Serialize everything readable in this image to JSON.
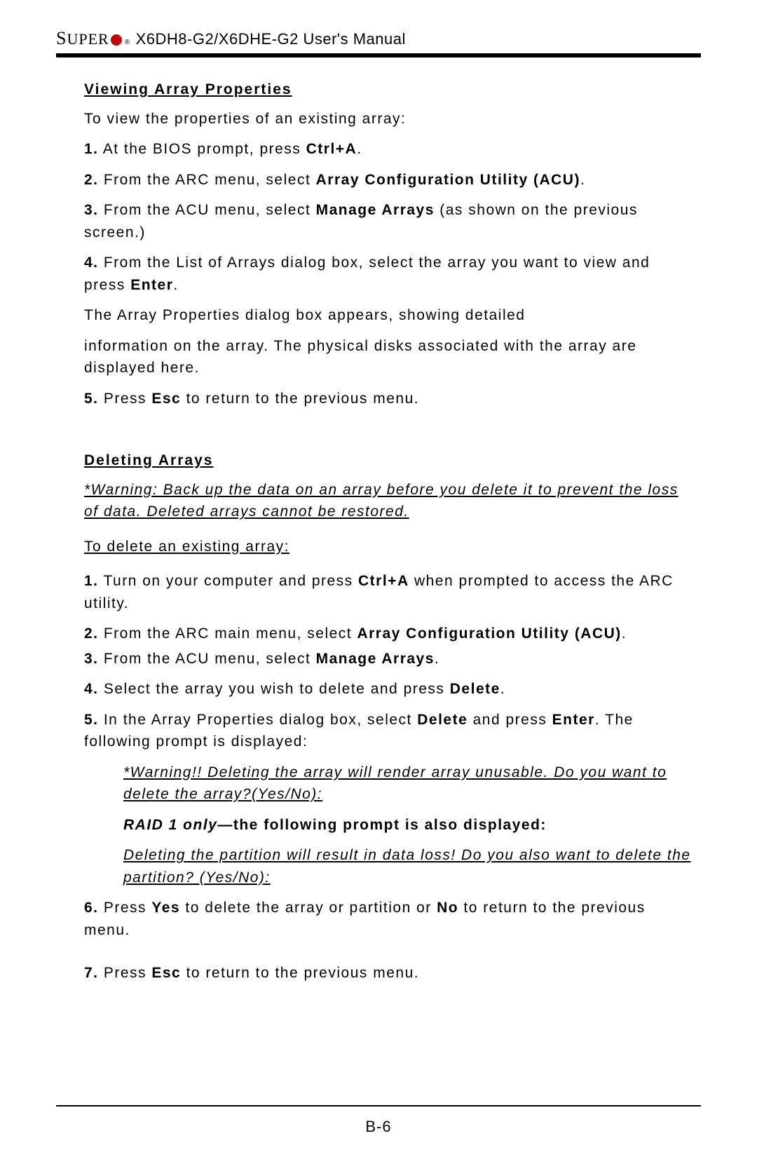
{
  "header": {
    "brand_prefix": "S",
    "brand_rest": "UPER",
    "registered": "®",
    "title": " X6DH8-G2/X6DHE-G2 User's Manual"
  },
  "section1": {
    "heading": "Viewing Array Properties",
    "intro": "To view the properties of an existing array:",
    "s1_pre": "1.",
    "s1_mid": " At the BIOS prompt, press ",
    "s1_b": "Ctrl+A",
    "s1_post": ".",
    "s2_pre": "2.",
    "s2_mid": " From the ARC menu, select ",
    "s2_b": "Array Configuration Utility (ACU)",
    "s2_post": ".",
    "s3_pre": "3.",
    "s3_mid": " From the ACU menu, select ",
    "s3_b": "Manage Arrays",
    "s3_post": " (as shown on the previous screen.)",
    "s4_pre": "4.",
    "s4_mid": " From the List of Arrays dialog box, select the array you want to view and press ",
    "s4_b": "Enter",
    "s4_post": ".",
    "p5": "The Array Properties dialog box appears, showing detailed",
    "p6": "information on the array. The physical disks associated with the array are displayed here.",
    "s5_pre": "5.",
    "s5_mid": " Press ",
    "s5_b": "Esc",
    "s5_post": " to return to the previous menu."
  },
  "section2": {
    "heading": "Deleting Arrays",
    "warning": "*Warning: Back up the data on an array before you delete it to prevent the loss of data.  Deleted arrays cannot be restored.",
    "intro": "To delete an existing array:",
    "s1_pre": "1.",
    "s1_mid": " Turn on your computer and press ",
    "s1_b": "Ctrl+A",
    "s1_post": " when prompted to access the ARC utility.",
    "s2_pre": "2.",
    "s2_mid": " From the ARC main menu, select ",
    "s2_b": "Array Configuration Utility (ACU)",
    "s2_post": ".",
    "s3_pre": "3.",
    "s3_mid": " From the ACU menu, select ",
    "s3_b": "Manage Arrays",
    "s3_post": ".",
    "s4_pre": "4.",
    "s4_mid": " Select the array you wish to delete and press ",
    "s4_b": "Delete",
    "s4_post": ".",
    "s5_pre": "5.",
    "s5_a": " In the Array Properties dialog box, select ",
    "s5_b1": "Delete",
    "s5_c": " and press ",
    "s5_b2": "Enter",
    "s5_d": ". The following prompt is displayed:",
    "warn2": "*Warning!! Deleting the array will render array unusable. Do you want to delete the array?(Yes/No):",
    "raid_pre": "RAID 1 only",
    "raid_post": "—the following prompt is also displayed:",
    "warn3": "Deleting the partition will result in data loss! Do you also want to delete the partition? (Yes/No):",
    "s6_pre": "6.",
    "s6_a": " Press ",
    "s6_b1": "Yes",
    "s6_c": " to delete the array or partition or ",
    "s6_b2": "No",
    "s6_d": " to return to the previous menu.",
    "s7_pre": "7.",
    "s7_mid": " Press ",
    "s7_b": "Esc",
    "s7_post": " to return to the previous menu."
  },
  "footer": {
    "page_number": "B-6"
  }
}
